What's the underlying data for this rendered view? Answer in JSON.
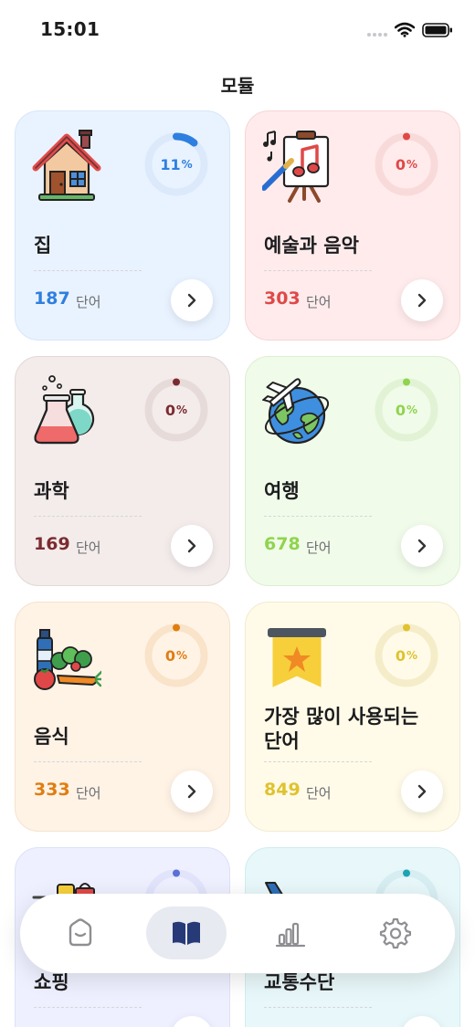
{
  "status_bar": {
    "time": "15:01"
  },
  "page_title": "모듈",
  "unit_label": "단어",
  "modules": [
    {
      "title": "집",
      "word_count": "187",
      "progress_percent": "11",
      "accent": "#2f7fe0",
      "tint_bg": "#e9f3ff",
      "border": "#d7e6f9",
      "ring_track": "#dbe9fb",
      "icon": "house-icon"
    },
    {
      "title": "예술과 음악",
      "word_count": "303",
      "progress_percent": "0",
      "accent": "#e04848",
      "tint_bg": "#ffebeb",
      "border": "#f7d5d5",
      "ring_track": "#f9dada",
      "icon": "art-music-icon"
    },
    {
      "title": "과학",
      "word_count": "169",
      "progress_percent": "0",
      "accent": "#7b2b30",
      "tint_bg": "#f3eceb",
      "border": "#e2d8d6",
      "ring_track": "#e7dbda",
      "icon": "science-flasks-icon"
    },
    {
      "title": "여행",
      "word_count": "678",
      "progress_percent": "0",
      "accent": "#8fd44e",
      "tint_bg": "#f1fbea",
      "border": "#dcefcf",
      "ring_track": "#e1f3d4",
      "icon": "travel-globe-icon"
    },
    {
      "title": "음식",
      "word_count": "333",
      "progress_percent": "0",
      "accent": "#e07d12",
      "tint_bg": "#fff3e6",
      "border": "#f6e2cc",
      "ring_track": "#f9e3c9",
      "icon": "food-groceries-icon"
    },
    {
      "title": "가장 많이 사용되는 단어",
      "word_count": "849",
      "progress_percent": "0",
      "accent": "#e0c22e",
      "tint_bg": "#fffbe8",
      "border": "#f2ead0",
      "ring_track": "#f5edc9",
      "icon": "star-ribbon-icon"
    },
    {
      "title": "쇼핑",
      "word_count": "",
      "progress_percent": "",
      "accent": "#5b6fd6",
      "tint_bg": "#eef0ff",
      "border": "#dde1f7",
      "ring_track": "#e1e4fb",
      "icon": "shopping-cart-icon"
    },
    {
      "title": "교통수단",
      "word_count": "",
      "progress_percent": "",
      "accent": "#1fa3b4",
      "tint_bg": "#e8f7f9",
      "border": "#d2ecef",
      "ring_track": "#d6eef1",
      "icon": "airplane-icon"
    }
  ],
  "tab_bar": {
    "tabs": [
      {
        "icon": "home-icon",
        "active": false
      },
      {
        "icon": "book-icon",
        "active": true
      },
      {
        "icon": "stats-chart-icon",
        "active": false
      },
      {
        "icon": "settings-gear-icon",
        "active": false
      }
    ]
  }
}
